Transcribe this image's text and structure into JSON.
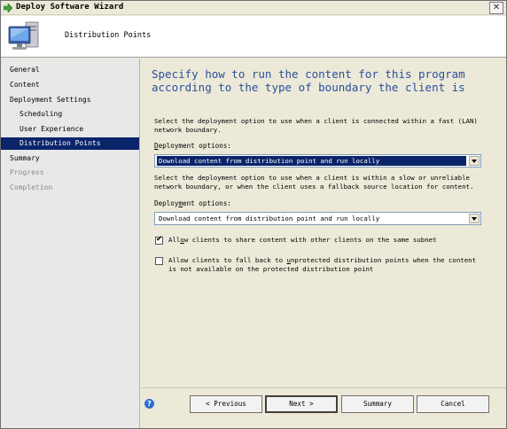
{
  "window": {
    "title": "Deploy Software Wizard",
    "close_glyph": "✕",
    "title_icon": "green-arrow-icon"
  },
  "header": {
    "page_title": "Distribution Points",
    "icon": "computer-monitor-icon"
  },
  "nav": {
    "items": [
      {
        "label": "General",
        "state": "normal"
      },
      {
        "label": "Content",
        "state": "normal"
      },
      {
        "label": "Deployment Settings",
        "state": "normal"
      },
      {
        "label": "Scheduling",
        "state": "normal"
      },
      {
        "label": "User Experience",
        "state": "normal"
      },
      {
        "label": "Distribution Points",
        "state": "selected"
      },
      {
        "label": "Summary",
        "state": "normal"
      },
      {
        "label": "Progress",
        "state": "disabled"
      },
      {
        "label": "Completion",
        "state": "disabled"
      }
    ]
  },
  "main": {
    "heading": "Specify how to run the content for this program according to the type of boundary the client is",
    "fast_desc": "Select the deployment option to use when a client is connected within a fast (LAN) network boundary.",
    "fast_label_mnemonic": "D",
    "fast_label_rest": "eployment options:",
    "fast_value": "Download content from distribution point and run locally",
    "slow_desc": "Select the deployment option to use when a client is within a slow or unreliable network boundary, or when the client uses a fallback source location for content.",
    "slow_label_pre": "Deploy",
    "slow_label_mnemonic": "m",
    "slow_label_post": "ent options:",
    "slow_value": "Download content from distribution point and run locally",
    "share_checked": true,
    "share_label_pre": "All",
    "share_label_mnemonic": "o",
    "share_label_post": "w clients to share content with other clients on the same subnet",
    "fallback_checked": false,
    "fallback_label_pre": "Allow clients to fall back to ",
    "fallback_label_mnemonic": "u",
    "fallback_label_post": "nprotected distribution points when the content is not available on the protected distribution point",
    "check_glyph": "✔"
  },
  "footer": {
    "help_glyph": "?",
    "previous_label": "< Previous",
    "next_label": "Next >",
    "summary_label": "Summary",
    "cancel_label": "Cancel"
  },
  "colors": {
    "accent": "#0a246a",
    "heading": "#2b4f9c",
    "panel": "#ece9d8",
    "nav_bg": "#e8e8e8"
  }
}
